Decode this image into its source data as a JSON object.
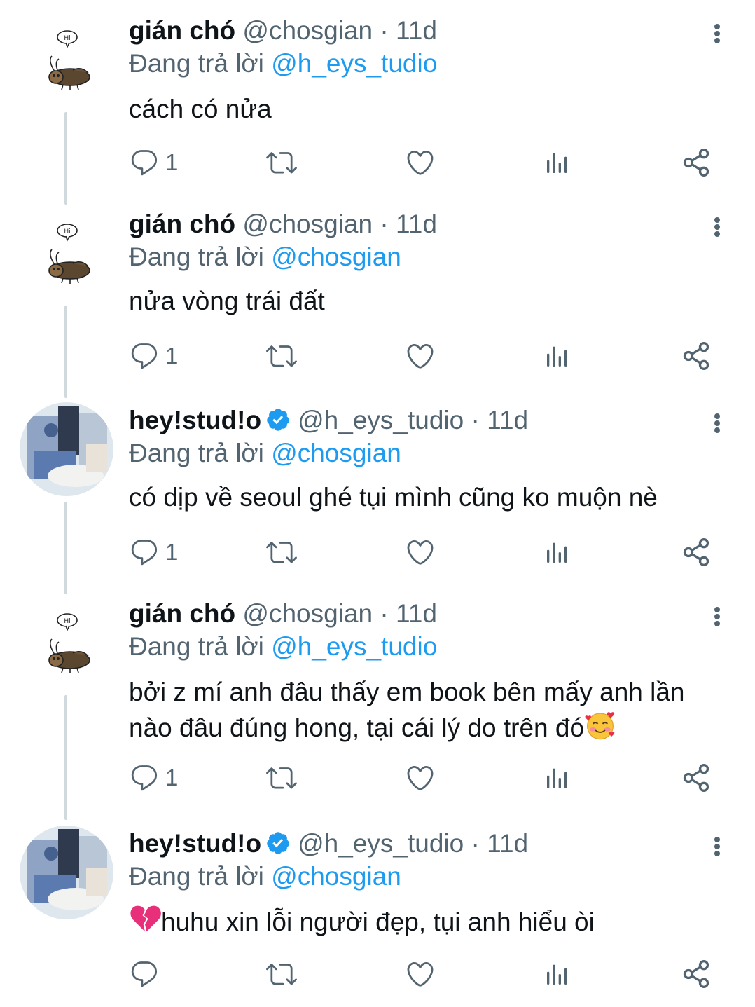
{
  "tweets": [
    {
      "name": "gián chó",
      "handle": "@chosgian",
      "dot": "·",
      "time": "11d",
      "replying_prefix": "Đang trả lời",
      "replying_to": "@h_eys_tudio",
      "text": "cách có nửa",
      "reply_count": "1",
      "avatar": "bug-hi-icon",
      "verified": false
    },
    {
      "name": "gián chó",
      "handle": "@chosgian",
      "dot": "·",
      "time": "11d",
      "replying_prefix": "Đang trả lời",
      "replying_to": "@chosgian",
      "text": "nửa vòng trái đất",
      "reply_count": "1",
      "avatar": "bug-hi-icon",
      "verified": false
    },
    {
      "name": "hey!stud!o",
      "handle": "@h_eys_tudio",
      "dot": "·",
      "time": "11d",
      "replying_prefix": "Đang trả lời",
      "replying_to": "@chosgian",
      "text": "có dịp về seoul ghé tụi mình cũng ko muộn nè",
      "reply_count": "1",
      "avatar": "photo",
      "verified": true
    },
    {
      "name": "gián chó",
      "handle": "@chosgian",
      "dot": "·",
      "time": "11d",
      "replying_prefix": "Đang trả lời",
      "replying_to": "@h_eys_tudio",
      "text_line1": "bởi z mí anh đâu thấy em book bên mấy anh lần",
      "text_line2": "nào đâu đúng hong, tại cái lý do trên đó",
      "text_emoji": "smiling-face-with-hearts",
      "reply_count": "1",
      "avatar": "bug-hi-icon",
      "verified": false
    },
    {
      "name": "hey!stud!o",
      "handle": "@h_eys_tudio",
      "dot": "·",
      "time": "11d",
      "replying_prefix": "Đang trả lời",
      "replying_to": "@chosgian",
      "text_emoji": "broken-heart",
      "text": "huhu xin lỗi người đẹp, tụi anh hiểu òi",
      "reply_count": "",
      "avatar": "photo",
      "verified": true
    }
  ],
  "colors": {
    "text": "#0f1419",
    "secondary": "#536471",
    "link": "#1d9bf0",
    "thread_line": "#cfd9de",
    "verified": "#1d9bf0"
  }
}
